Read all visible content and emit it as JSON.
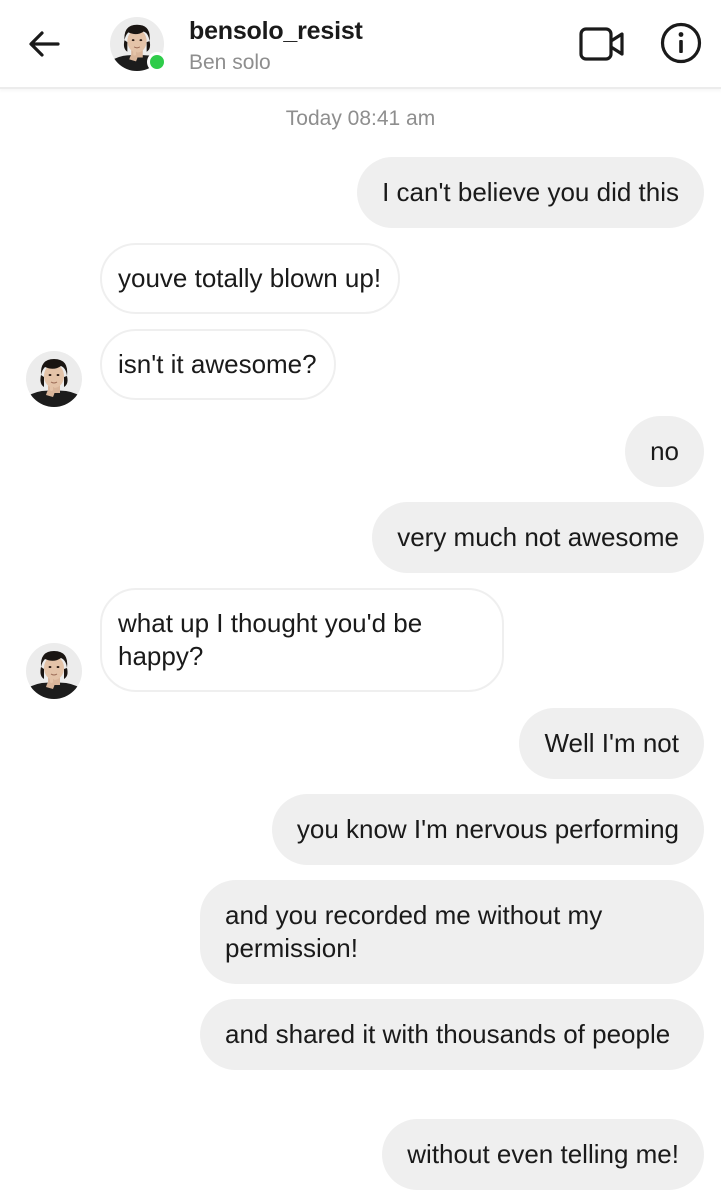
{
  "header": {
    "username": "bensolo_resist",
    "display_name": "Ben solo",
    "online": true
  },
  "conversation": {
    "timestamp": "Today 08:41 am",
    "messages": [
      {
        "direction": "outgoing",
        "text": "I can't believe you did this"
      },
      {
        "direction": "incoming",
        "text": "youve totally blown up!"
      },
      {
        "direction": "incoming",
        "text": "isn't it awesome?"
      },
      {
        "direction": "outgoing",
        "text": "no"
      },
      {
        "direction": "outgoing",
        "text": "very much not awesome"
      },
      {
        "direction": "incoming",
        "text": "what up I thought you'd be happy?"
      },
      {
        "direction": "outgoing",
        "text": "Well I'm not"
      },
      {
        "direction": "outgoing",
        "text": "you know I'm nervous performing"
      },
      {
        "direction": "outgoing",
        "text": "and you recorded me without my permission!"
      },
      {
        "direction": "outgoing",
        "text": "and shared it with thousands of people"
      },
      {
        "direction": "outgoing",
        "text": "without even telling me!"
      }
    ]
  },
  "colors": {
    "outgoing_bubble": "#efefef",
    "incoming_border": "#efefef",
    "online_dot": "#2ecc4a",
    "muted_text": "#8e8e8e"
  }
}
